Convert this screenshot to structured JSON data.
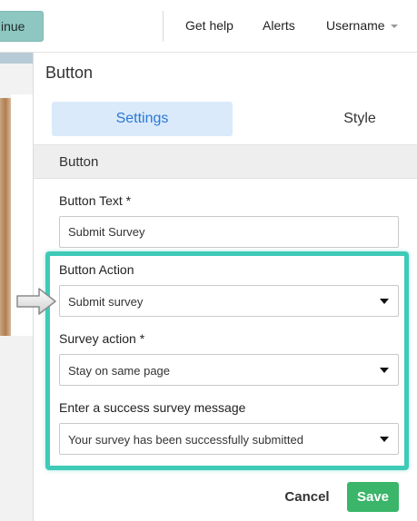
{
  "topbar": {
    "continue_label": "inue",
    "nav": {
      "help": "Get help",
      "alerts": "Alerts",
      "username": "Username"
    }
  },
  "panel": {
    "title": "Button",
    "tabs": [
      {
        "label": "Settings",
        "active": true
      },
      {
        "label": "Style",
        "active": false
      }
    ],
    "section": "Button",
    "fields": {
      "button_text": {
        "label": "Button Text *",
        "value": "Submit Survey"
      },
      "button_action": {
        "label": "Button Action",
        "value": "Submit survey"
      },
      "survey_action": {
        "label": "Survey action *",
        "value": "Stay on same page"
      },
      "success_message": {
        "label": "Enter a success survey message",
        "value": "Your survey has been successfully submitted"
      }
    },
    "actions": {
      "cancel": "Cancel",
      "save": "Save"
    }
  },
  "colors": {
    "accent": "#2a78d6",
    "highlight": "#3fcab8",
    "save": "#3ab56a",
    "continue": "#8ec7c1"
  },
  "icons": [
    "chevron-down-icon",
    "dropdown-arrow-icon",
    "pointer-arrow-icon"
  ]
}
